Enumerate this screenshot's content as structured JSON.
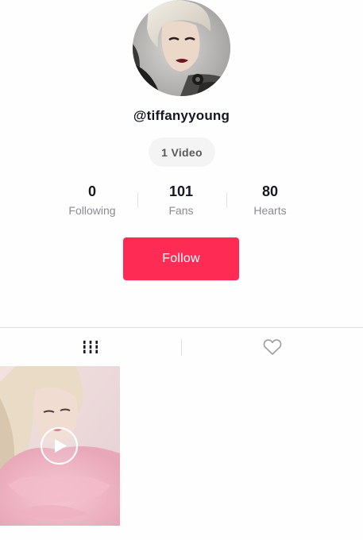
{
  "profile": {
    "username": "@tiffanyyoung",
    "video_count_label": "1 Video"
  },
  "stats": [
    {
      "value": "0",
      "label": "Following"
    },
    {
      "value": "101",
      "label": "Fans"
    },
    {
      "value": "80",
      "label": "Hearts"
    }
  ],
  "actions": {
    "follow_label": "Follow"
  },
  "tabs": [
    {
      "icon": "videos-grid-icon",
      "selected": true
    },
    {
      "icon": "heart-outline-icon",
      "selected": false
    }
  ],
  "colors": {
    "accent": "#fe2c55",
    "text_primary": "#161823",
    "text_secondary": "#8a8b91",
    "pill_bg": "#f4f4f4"
  },
  "videos": [
    {
      "thumbnail": "pink-fur-portrait",
      "icon": "play-icon"
    }
  ]
}
